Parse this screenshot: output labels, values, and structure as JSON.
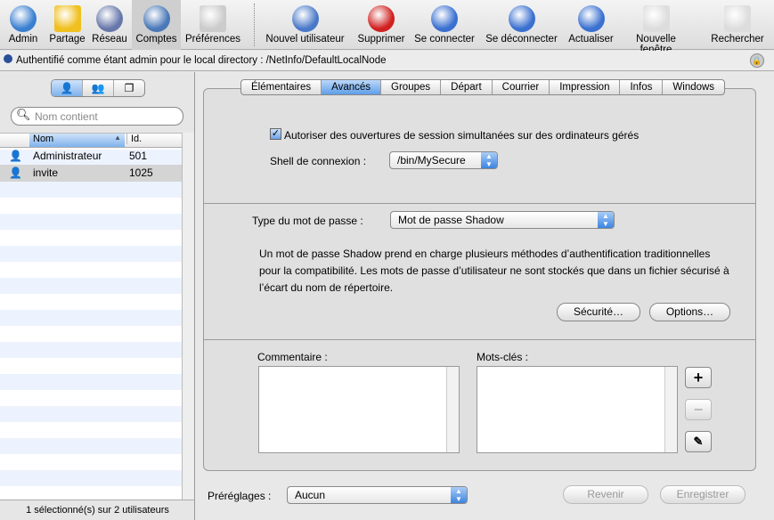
{
  "toolbar": {
    "items": [
      {
        "label": "Admin",
        "icon": "admin-globe-icon",
        "color": "#3a7fd0"
      },
      {
        "label": "Partage",
        "icon": "sharing-sign-icon",
        "color": "#f0c020"
      },
      {
        "label": "Réseau",
        "icon": "network-globe-icon",
        "color": "#6677aa"
      },
      {
        "label": "Comptes",
        "icon": "accounts-user-icon",
        "color": "#4a78b8"
      },
      {
        "label": "Préférences",
        "icon": "preferences-switch-icon",
        "color": "#cccccc"
      },
      {
        "label": "Nouvel utilisateur",
        "icon": "plus-icon",
        "color": "#4a78c8"
      },
      {
        "label": "Supprimer",
        "icon": "delete-icon",
        "color": "#d02020"
      },
      {
        "label": "Se connecter",
        "icon": "connect-icon",
        "color": "#3a70d0"
      },
      {
        "label": "Se déconnecter",
        "icon": "disconnect-icon",
        "color": "#3a70d0"
      },
      {
        "label": "Actualiser",
        "icon": "refresh-icon",
        "color": "#3a70d0"
      },
      {
        "label": "Nouvelle fenêtre",
        "icon": "new-window-icon",
        "color": "#dddddd"
      },
      {
        "label": "Rechercher",
        "icon": "search-documents-icon",
        "color": "#dddddd"
      }
    ],
    "selected": "Comptes"
  },
  "status": {
    "text": "Authentifié comme étant admin pour le local directory : /NetInfo/DefaultLocalNode"
  },
  "sidebar": {
    "search_placeholder": "Nom contient",
    "columns": [
      "Nom",
      "Id."
    ],
    "rows": [
      {
        "name": "Administrateur",
        "id": "501"
      },
      {
        "name": "invite",
        "id": "1025"
      }
    ],
    "footer": "1 sélectionné(s) sur 2 utilisateurs"
  },
  "tabs": [
    "Élémentaires",
    "Avancés",
    "Groupes",
    "Départ",
    "Courrier",
    "Impression",
    "Infos",
    "Windows"
  ],
  "active_tab": "Avancés",
  "advanced": {
    "checkbox_label": "Autoriser des ouvertures de session simultanées sur des ordinateurs gérés",
    "checkbox_checked": true,
    "shell_label": "Shell de connexion :",
    "shell_value": "/bin/MySecure",
    "pw_type_label": "Type du mot de passe :",
    "pw_type_value": "Mot de passe Shadow",
    "pw_description": "Un mot de passe Shadow prend en charge plusieurs méthodes d’authentification traditionnelles pour la compatibilité. Les mots de passe d’utilisateur ne sont stockés que dans un fichier sécurisé à l’écart du nom de répertoire.",
    "security_button": "Sécurité…",
    "options_button": "Options…",
    "comment_label": "Commentaire :",
    "keywords_label": "Mots-clés :"
  },
  "footer": {
    "presets_label": "Préréglages :",
    "presets_value": "Aucun",
    "revert": "Revenir",
    "save": "Enregistrer"
  }
}
